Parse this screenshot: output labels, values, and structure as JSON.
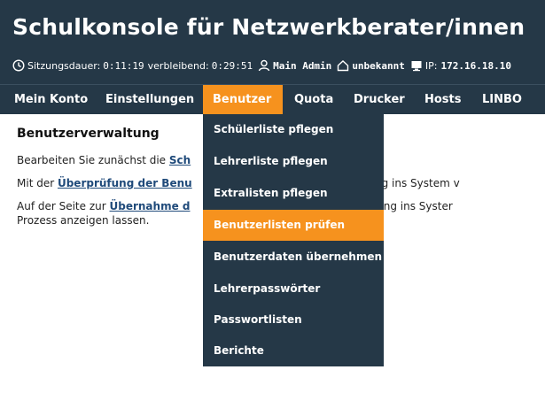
{
  "header": {
    "title": "Schulkonsole für Netzwerkberater/innen",
    "session_label": "Sitzungsdauer:",
    "session_time": "0:11:19",
    "remaining_label": "verbleibend:",
    "remaining_time": "0:29:51",
    "user": "Main Admin",
    "room": "unbekannt",
    "ip_label": "IP:",
    "ip": "172.16.18.10"
  },
  "nav": {
    "items": [
      {
        "label": "Mein Konto"
      },
      {
        "label": "Einstellungen"
      },
      {
        "label": "Benutzer"
      },
      {
        "label": "Quota"
      },
      {
        "label": "Drucker"
      },
      {
        "label": "Hosts"
      },
      {
        "label": "LINBO"
      }
    ],
    "active_index": 2
  },
  "content": {
    "heading": "Benutzerverwaltung",
    "p1_pre": "Bearbeiten Sie zunächst die ",
    "p1_link": "Sch",
    "p2_pre": "Mit der ",
    "p2_link": "Überprüfung der Benu",
    "p2_post": "ur Übertragung ins System v",
    "p3_pre": "Auf der Seite zur ",
    "p3_link": "Übernahme d",
    "p3_post": "e die Übertragung ins Syster",
    "p3_line2": "Prozess anzeigen lassen."
  },
  "dropdown": {
    "items": [
      {
        "label": "Schülerliste pflegen"
      },
      {
        "label": "Lehrerliste pflegen"
      },
      {
        "label": "Extralisten pflegen"
      },
      {
        "label": "Benutzerlisten prüfen"
      },
      {
        "label": "Benutzerdaten übernehmen"
      },
      {
        "label": "Lehrerpasswörter"
      },
      {
        "label": "Passwortlisten"
      },
      {
        "label": "Berichte"
      }
    ],
    "active_index": 3
  },
  "colors": {
    "header_bg": "#253847",
    "accent": "#f6921e",
    "link": "#1f4a7a"
  }
}
